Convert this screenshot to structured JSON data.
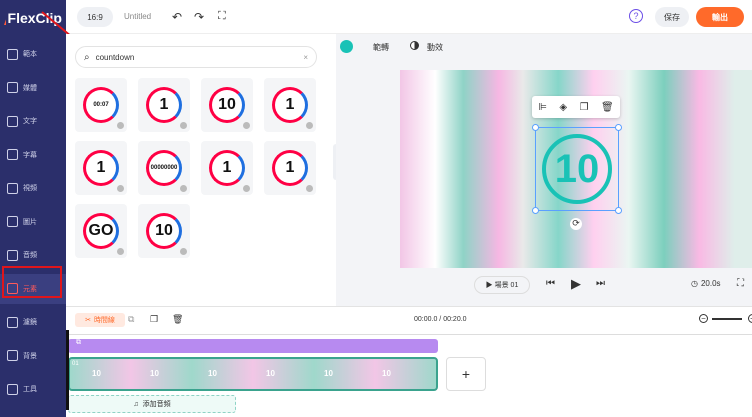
{
  "app": {
    "name": "FlexClip",
    "aspect": "16:9",
    "doc_title": "Untitled"
  },
  "topbar": {
    "save_label": "保存",
    "export_label": "輸出",
    "help": "?"
  },
  "sidebar": {
    "items": [
      {
        "label": "範本",
        "active": false
      },
      {
        "label": "媒體",
        "active": false
      },
      {
        "label": "文字",
        "active": false
      },
      {
        "label": "字幕",
        "active": false
      },
      {
        "label": "視頻",
        "active": false
      },
      {
        "label": "圖片",
        "active": false
      },
      {
        "label": "音頻",
        "active": false
      },
      {
        "label": "元素",
        "active": true
      },
      {
        "label": "濾鏡",
        "active": false
      },
      {
        "label": "背景",
        "active": false
      },
      {
        "label": "工具",
        "active": false
      }
    ]
  },
  "search": {
    "value": "countdown"
  },
  "tiles": [
    "00:07",
    "1",
    "10",
    "1",
    "1",
    "00000000",
    "1",
    "1",
    "GO",
    "10"
  ],
  "canvas_toolbar": {
    "range_label": "範轉",
    "animate_label": "動效"
  },
  "canvas": {
    "number": "10"
  },
  "player": {
    "scene_label": "▶ 場景 01",
    "duration": "20.0s"
  },
  "timeline": {
    "tab_label": "時間線",
    "time": "00:00.0 / 00:20.0",
    "add_audio_label": "添加音頻",
    "clip_index": "01",
    "clip_labels": [
      "10",
      "10",
      "10",
      "10",
      "10",
      "10"
    ]
  },
  "colors": {
    "sidebar": "#2b2f6b",
    "export": "#ff6a2a",
    "accent": "#19c2b6"
  }
}
